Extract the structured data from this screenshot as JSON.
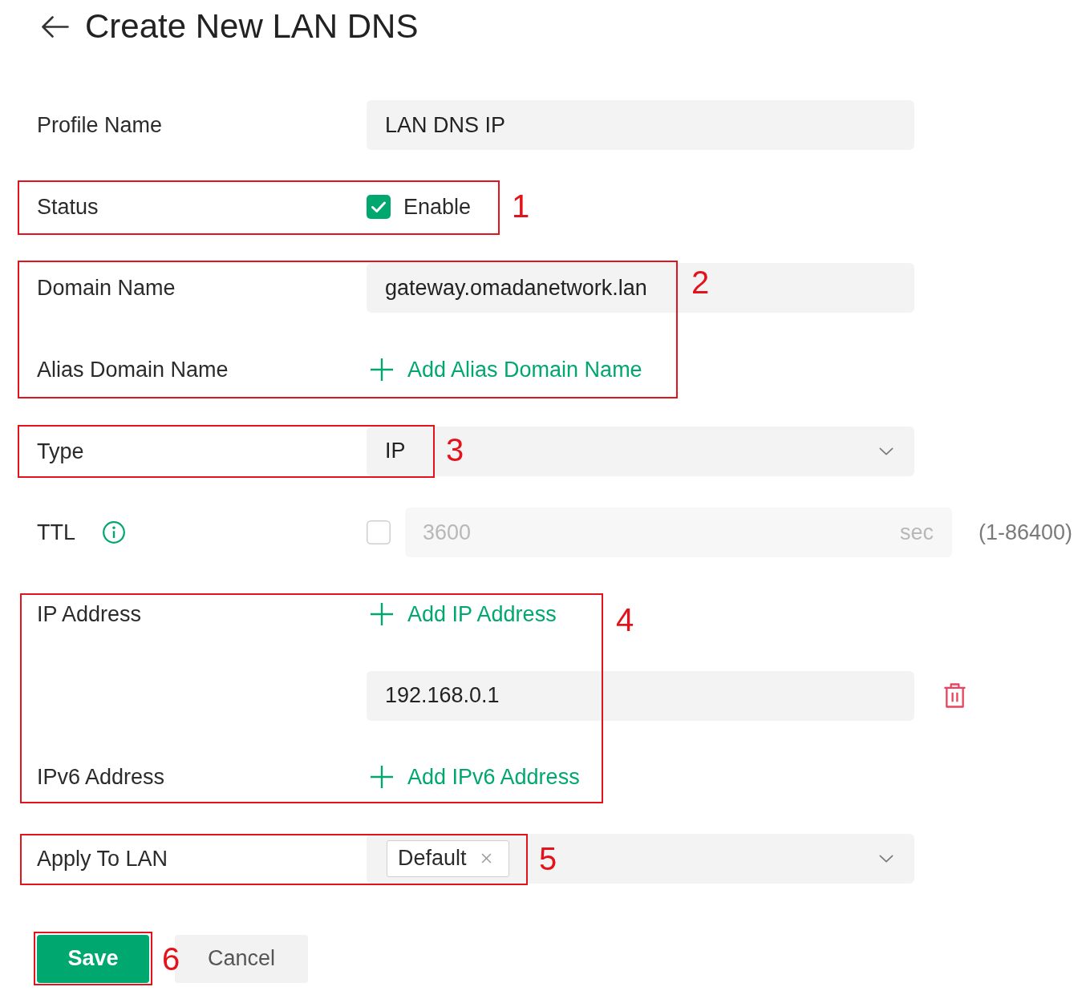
{
  "header": {
    "title": "Create New LAN DNS"
  },
  "form": {
    "rows": [
      {
        "kind": "text",
        "label": "Profile Name",
        "value": "LAN DNS IP"
      },
      {
        "kind": "checkbox",
        "label": "Status",
        "checked": true,
        "option": "Enable"
      },
      {
        "kind": "text",
        "label": "Domain Name",
        "value": "gateway.omadanetwork.lan"
      },
      {
        "kind": "add",
        "label": "Alias Domain Name",
        "action": "Add Alias Domain Name"
      },
      {
        "kind": "select",
        "label": "Type",
        "value": "IP"
      },
      {
        "kind": "number",
        "label": "TTL",
        "checked": false,
        "value": "3600",
        "unit": "sec",
        "range": "(1-86400)"
      },
      {
        "kind": "add",
        "label": "IP Address",
        "action": "Add IP Address",
        "entries": [
          {
            "value": "192.168.0.1"
          }
        ]
      },
      {
        "kind": "add",
        "label": "IPv6 Address",
        "action": "Add IPv6 Address"
      },
      {
        "kind": "tags",
        "label": "Apply To LAN",
        "tags": [
          "Default"
        ]
      }
    ]
  },
  "actions": [
    {
      "kind": "primary",
      "label": "Save"
    },
    {
      "kind": "secondary",
      "label": "Cancel"
    }
  ],
  "annotations": [
    {
      "number": "1"
    },
    {
      "number": "2"
    },
    {
      "number": "3"
    },
    {
      "number": "4"
    },
    {
      "number": "5"
    },
    {
      "number": "6"
    }
  ]
}
